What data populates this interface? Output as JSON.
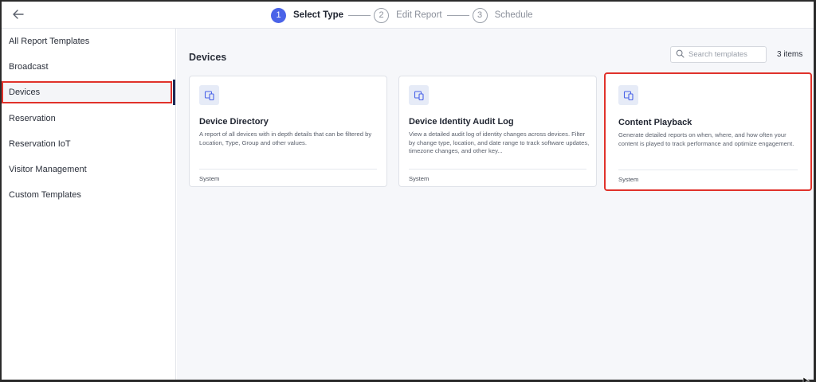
{
  "header": {
    "steps": [
      {
        "num": "1",
        "label": "Select Type"
      },
      {
        "num": "2",
        "label": "Edit Report"
      },
      {
        "num": "3",
        "label": "Schedule"
      }
    ]
  },
  "sidebar": {
    "items": [
      {
        "label": "All Report Templates"
      },
      {
        "label": "Broadcast"
      },
      {
        "label": "Devices"
      },
      {
        "label": "Reservation"
      },
      {
        "label": "Reservation IoT"
      },
      {
        "label": "Visitor Management"
      },
      {
        "label": "Custom Templates"
      }
    ]
  },
  "main": {
    "section_title": "Devices",
    "search_placeholder": "Search templates",
    "item_count": "3 items",
    "cards": [
      {
        "title": "Device Directory",
        "description": "A report of all devices with in depth details that can be filtered by Location, Type, Group and other values.",
        "footer": "System"
      },
      {
        "title": "Device Identity Audit Log",
        "description": "View a detailed audit log of identity changes across devices. Filter by change type, location, and date range to track software updates, timezone changes, and other key...",
        "footer": "System"
      },
      {
        "title": "Content Playback",
        "description": "Generate detailed reports on when, where, and how often your content is played to track performance and optimize engagement.",
        "footer": "System"
      }
    ]
  },
  "colors": {
    "accent": "#4a63e8",
    "highlight": "#e0322b",
    "icon_bg": "#e6ebf7"
  }
}
